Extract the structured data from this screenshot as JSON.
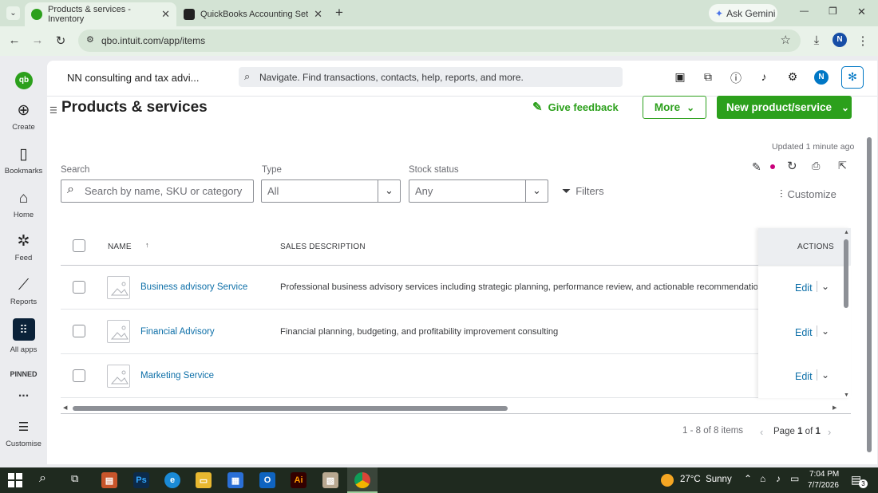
{
  "browser": {
    "tabs": [
      {
        "title": "Products & services - Inventory"
      },
      {
        "title": "QuickBooks Accounting Setup"
      }
    ],
    "new_tab": "+",
    "ask_gemini": "Ask Gemini",
    "url": "qbo.intuit.com/app/items",
    "profile_initial": "N",
    "window_controls": {
      "minimize": "—",
      "restore": "❐",
      "close": "✕"
    }
  },
  "leftnav": {
    "items": [
      {
        "label": "Create",
        "icon": "plus-circle-icon"
      },
      {
        "label": "Bookmarks",
        "icon": "bookmark-icon"
      },
      {
        "label": "Home",
        "icon": "home-icon"
      },
      {
        "label": "Feed",
        "icon": "sparkle-icon"
      },
      {
        "label": "Reports",
        "icon": "chart-icon"
      },
      {
        "label": "All apps",
        "icon": "grid-icon"
      }
    ],
    "pinned": "PINNED",
    "more": "...",
    "customise": "Customise"
  },
  "topbar": {
    "company": "NN consulting and tax advi...",
    "search_placeholder": "Navigate. Find transactions, contacts, help, reports, and more.",
    "avatar": "N"
  },
  "page": {
    "title": "Products & services",
    "give_feedback": "Give feedback",
    "more": "More",
    "new_item": "New product/service",
    "updated": "Updated 1 minute ago",
    "customize": "Customize"
  },
  "filters": {
    "search_label": "Search",
    "search_placeholder": "Search by name, SKU or category",
    "type_label": "Type",
    "type_value": "All",
    "stock_label": "Stock status",
    "stock_value": "Any",
    "filters_button": "Filters"
  },
  "table": {
    "columns": {
      "name": "NAME",
      "sort": "↑",
      "description": "SALES DESCRIPTION",
      "actions": "ACTIONS"
    },
    "rows": [
      {
        "name": "Business advisory Service",
        "description": "Professional business advisory services including strategic planning, performance review, and actionable recommendations fo",
        "action": "Edit"
      },
      {
        "name": "Financial Advisory",
        "description": "Financial planning, budgeting, and profitability improvement consulting",
        "action": "Edit"
      },
      {
        "name": "Marketing Service",
        "description": "",
        "action": "Edit"
      }
    ]
  },
  "pagination": {
    "summary": "1 - 8 of 8 items",
    "page_prefix": "Page",
    "page_current": "1",
    "page_of": "of",
    "page_total": "1"
  },
  "taskbar": {
    "weather": "27°C  Sunny",
    "time": "7:04 PM",
    "date": "7/7/2026",
    "notifications": "3"
  },
  "colors": {
    "brand_green": "#2ca01c",
    "link_blue": "#0d6fa8",
    "chrome_green": "#d3e3d4"
  }
}
